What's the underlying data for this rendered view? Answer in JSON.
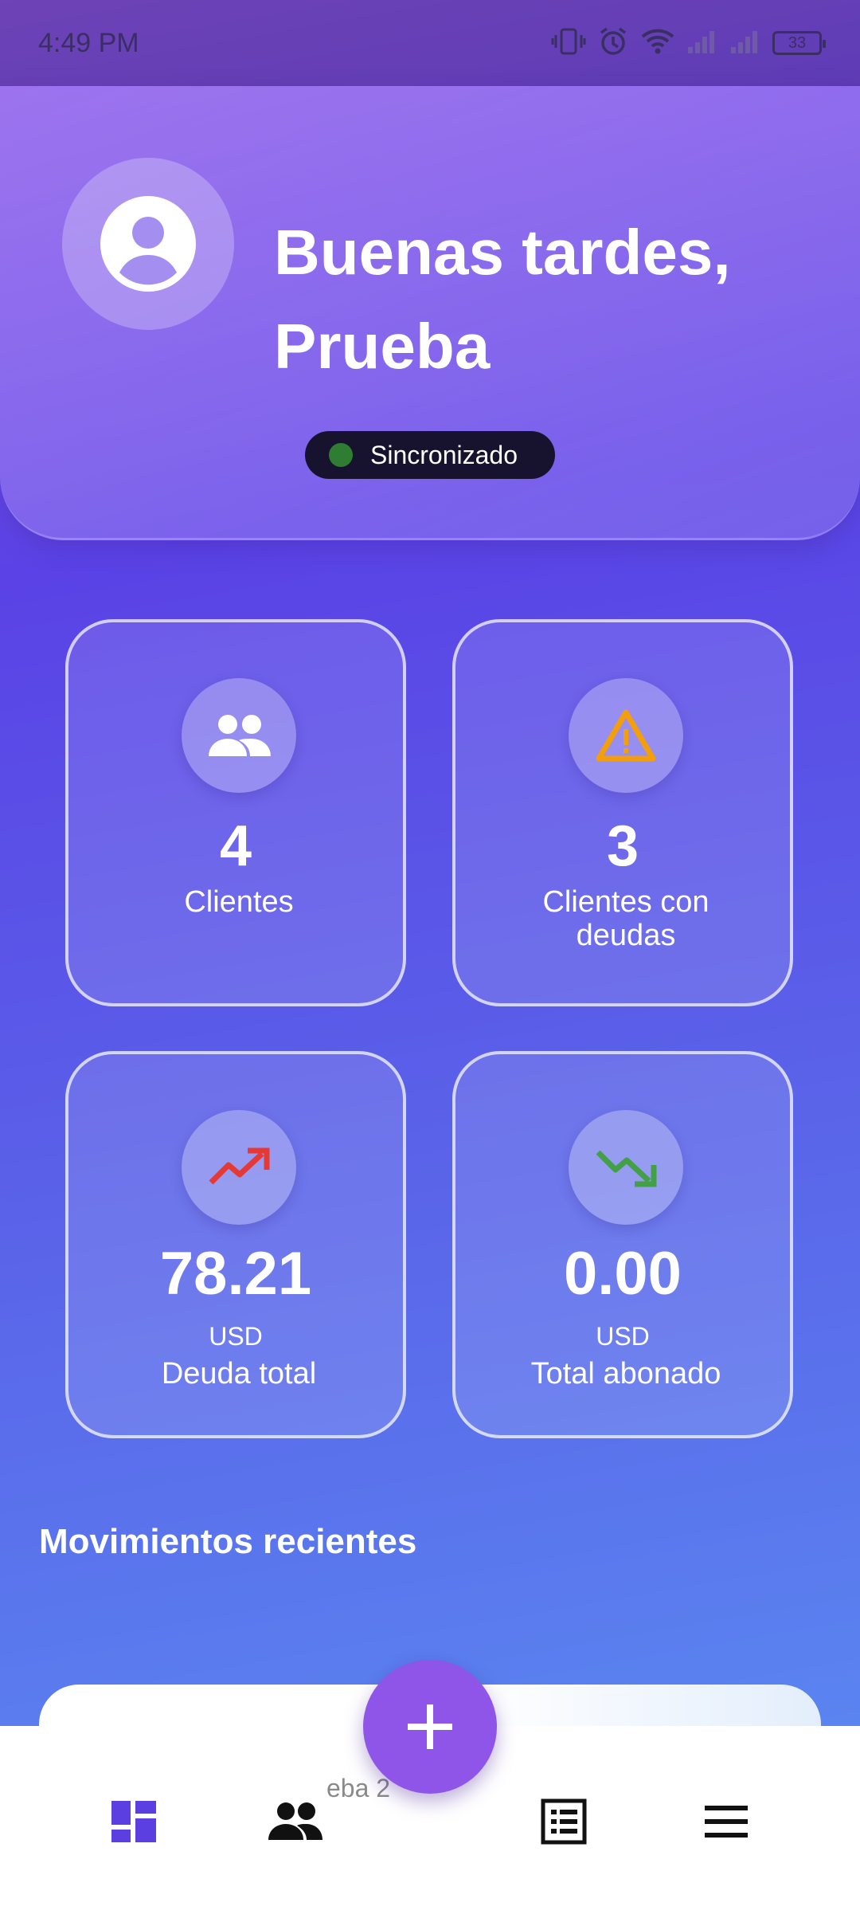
{
  "status_bar": {
    "time": "4:49 PM",
    "battery": "33"
  },
  "header": {
    "greeting_line1": "Buenas tardes,",
    "greeting_line2": "Prueba",
    "sync_status": "Sincronizado"
  },
  "stats": [
    {
      "value": "4",
      "label": "Clientes",
      "icon": "people-icon"
    },
    {
      "value": "3",
      "label_line1": "Clientes con",
      "label_line2": "deudas",
      "icon": "warning-icon"
    },
    {
      "value": "78.21",
      "unit": "USD",
      "label": "Deuda total",
      "icon": "trending-up-icon"
    },
    {
      "value": "0.00",
      "unit": "USD",
      "label": "Total abonado",
      "icon": "trending-down-icon"
    }
  ],
  "recent": {
    "title": "Movimientos recientes",
    "partial_item_text": "eba 2"
  },
  "nav": {
    "items": [
      "dashboard-icon",
      "people-icon",
      "list-icon",
      "menu-icon"
    ],
    "fab": "add-icon"
  },
  "colors": {
    "accent": "#8f55e8",
    "nav_active": "#5b3fe0",
    "warning": "#f59e0b",
    "up": "#e53935",
    "down": "#43a047",
    "sync_ok": "#2e7d32"
  }
}
